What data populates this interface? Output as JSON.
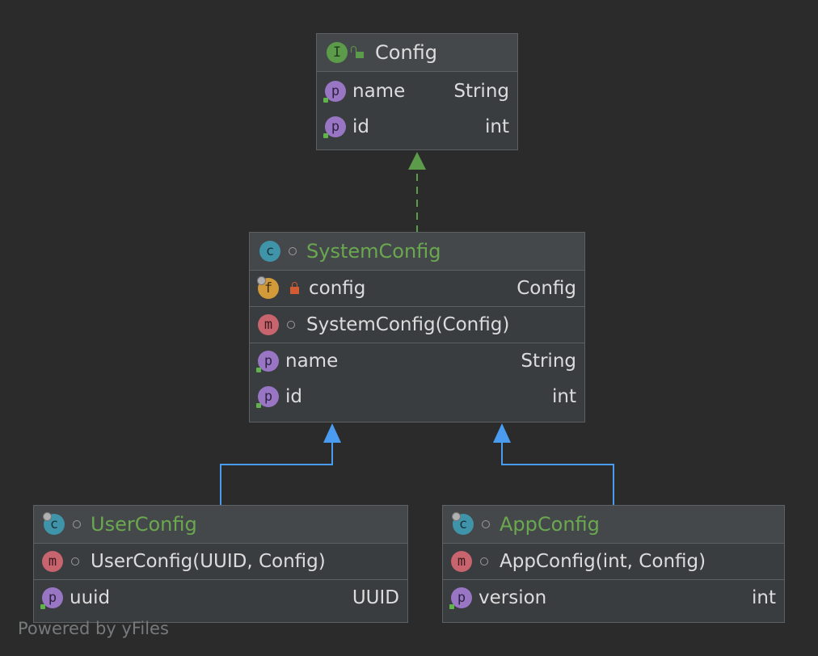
{
  "nodes": {
    "config": {
      "kind": "I",
      "title": "Config",
      "sections": [
        [
          {
            "badge": "p",
            "name": "name",
            "type": "String"
          },
          {
            "badge": "p",
            "name": "id",
            "type": "int"
          }
        ]
      ]
    },
    "system_config": {
      "kind": "c",
      "title": "SystemConfig",
      "field": {
        "badge": "f",
        "name": "config",
        "type": "Config"
      },
      "constructor": {
        "badge": "m",
        "name": "SystemConfig(Config)"
      },
      "properties": [
        {
          "badge": "p",
          "name": "name",
          "type": "String"
        },
        {
          "badge": "p",
          "name": "id",
          "type": "int"
        }
      ]
    },
    "user_config": {
      "kind": "c",
      "title": "UserConfig",
      "constructor": {
        "badge": "m",
        "name": "UserConfig(UUID, Config)"
      },
      "properties": [
        {
          "badge": "p",
          "name": "uuid",
          "type": "UUID"
        }
      ]
    },
    "app_config": {
      "kind": "c",
      "title": "AppConfig",
      "constructor": {
        "badge": "m",
        "name": "AppConfig(int, Config)"
      },
      "properties": [
        {
          "badge": "p",
          "name": "version",
          "type": "int"
        }
      ]
    }
  },
  "edges": [
    {
      "from": "system_config",
      "to": "config",
      "style": "dashed",
      "color": "#5b9b4a",
      "relation": "implements"
    },
    {
      "from": "user_config",
      "to": "system_config",
      "style": "solid",
      "color": "#4a9cf0",
      "relation": "extends"
    },
    {
      "from": "app_config",
      "to": "system_config",
      "style": "solid",
      "color": "#4a9cf0",
      "relation": "extends"
    }
  ],
  "footer": "Powered by yFiles"
}
